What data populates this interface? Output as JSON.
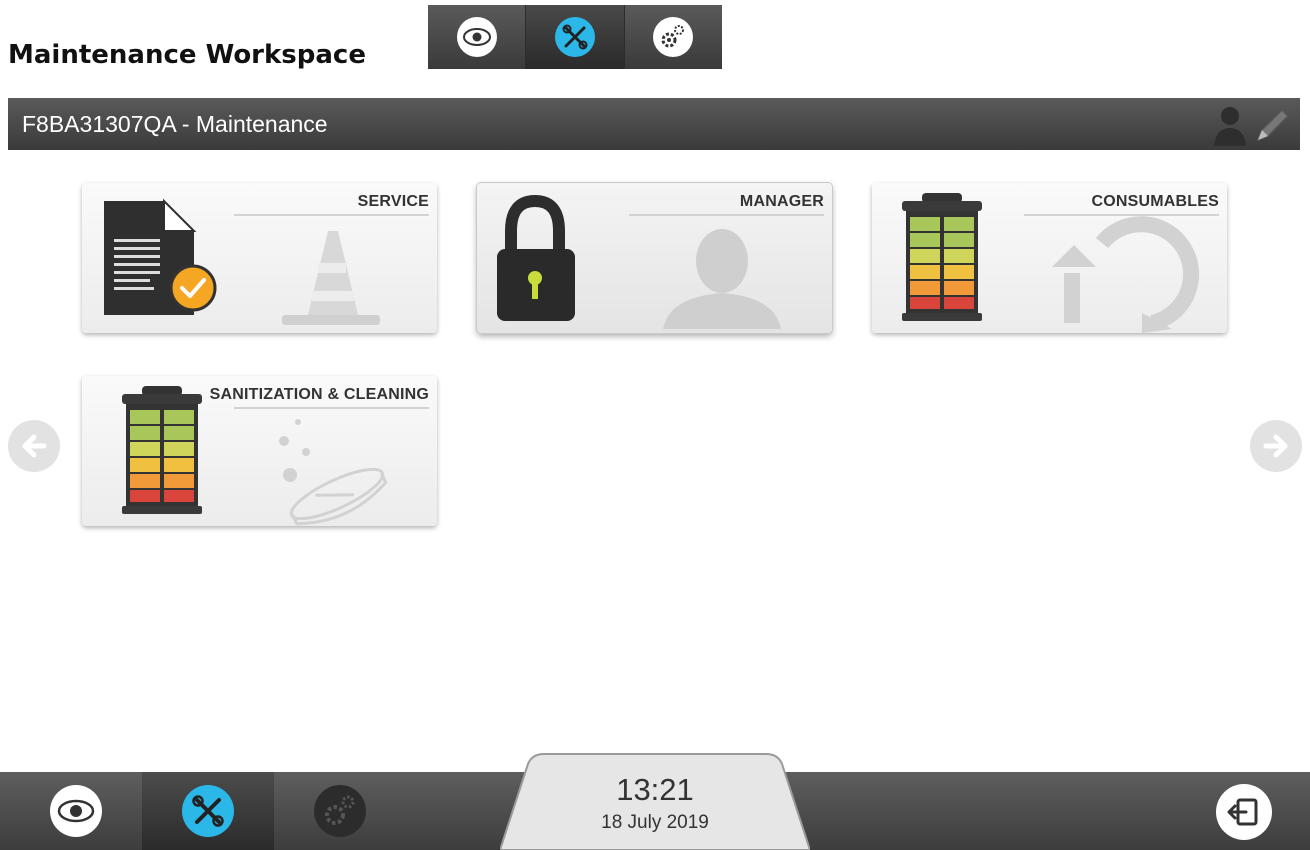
{
  "page": {
    "title": "Maintenance Workspace"
  },
  "mode_tabs": [
    {
      "icon": "eye-icon",
      "active": false
    },
    {
      "icon": "tools-icon",
      "active": true
    },
    {
      "icon": "gears-icon",
      "active": false
    }
  ],
  "device_bar": {
    "title": "F8BA31307QA - Maintenance",
    "icons": [
      "user-icon",
      "pencil-icon"
    ]
  },
  "tiles": [
    {
      "label": "SERVICE",
      "icons": [
        "document-check-icon",
        "traffic-cone-icon"
      ]
    },
    {
      "label": "MANAGER",
      "icons": [
        "padlock-icon",
        "person-silhouette-icon"
      ],
      "selected": true
    },
    {
      "label": "CONSUMABLES",
      "icons": [
        "canister-levels-icon",
        "refresh-arrows-icon"
      ]
    },
    {
      "label": "SANITIZATION & CLEANING",
      "icons": [
        "canister-levels-icon",
        "tablet-bubbles-icon"
      ]
    }
  ],
  "navigation": {
    "previous_icon": "arrow-left-icon",
    "next_icon": "arrow-right-icon"
  },
  "bottom_bar": {
    "buttons": [
      {
        "icon": "eye-icon",
        "active": false
      },
      {
        "icon": "tools-icon",
        "active": true
      },
      {
        "icon": "gears-icon",
        "active": false
      }
    ],
    "time": "13:21",
    "date": "18 July 2019",
    "exit_icon": "exit-icon"
  },
  "colors": {
    "accent_blue": "#2bb8e8",
    "bar_dark": "#3a3a3a",
    "check_orange": "#f5a623",
    "level_green": "#a8c65a",
    "level_yellow": "#f0c040",
    "level_orange": "#f19a3a",
    "level_red": "#d9453a"
  }
}
